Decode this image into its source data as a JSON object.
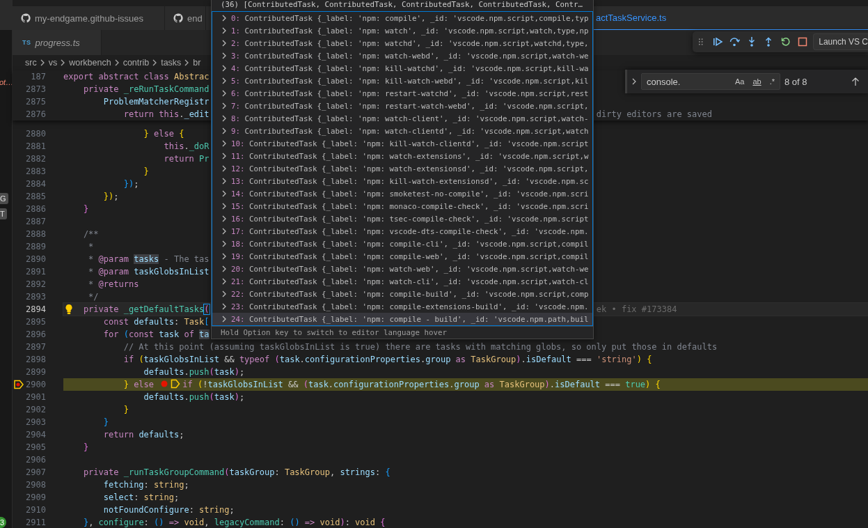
{
  "sidebar_edge": {
    "items": [
      {
        "kind": "text",
        "text": "ot…"
      },
      {
        "kind": "badge",
        "text": "G"
      },
      {
        "kind": "badge",
        "text": "T"
      },
      {
        "kind": "count",
        "text": "3"
      }
    ]
  },
  "tab_rows": [
    [
      {
        "label": "my-endgame.github-issues",
        "kind": "remote",
        "selected": false,
        "preview": false
      },
      {
        "label": "end",
        "kind": "remote",
        "selected": false,
        "preview": false
      },
      {
        "label": "actTaskService.ts",
        "kind": "file",
        "selected": true,
        "preview": false
      }
    ],
    [
      {
        "label": "progress.ts",
        "kind": "file",
        "file_type": "TS",
        "selected": false,
        "preview": true
      }
    ]
  ],
  "breadcrumbs": [
    "src",
    "vs",
    "workbench",
    "contrib",
    "tasks",
    "br"
  ],
  "editor": {
    "sticky_lines": [
      {
        "number": "187",
        "tokens": [
          {
            "text": "export abstract class ",
            "kind": "keyword"
          },
          {
            "text": "Abstrac",
            "kind": "type"
          }
        ]
      },
      {
        "number": "2873",
        "tokens": [
          {
            "text": "    private ",
            "kind": "keyword"
          },
          {
            "text": "_reRunTaskCommand",
            "kind": "function"
          }
        ]
      },
      {
        "number": "2875",
        "tokens": [
          {
            "text": "        ProblemMatcherRegistr",
            "kind": "variable"
          }
        ]
      },
      {
        "number": "2876",
        "tokens": [
          {
            "text": "            return this",
            "kind": "keyword"
          },
          {
            "text": ".",
            "kind": "plain"
          },
          {
            "text": "_edit",
            "kind": "variable"
          }
        ],
        "tail": [
          {
            "text": "dirty editors are saved",
            "kind": "comment"
          }
        ]
      }
    ],
    "lines": [
      {
        "number": "2880",
        "current": false,
        "paused": false,
        "tokens": [
          {
            "text": "                }",
            "kind": "bracket1"
          },
          {
            "text": " else ",
            "kind": "keyword"
          },
          {
            "text": "{",
            "kind": "bracket1"
          }
        ]
      },
      {
        "number": "2881",
        "current": false,
        "paused": false,
        "tokens": [
          {
            "text": "                    this",
            "kind": "keyword"
          },
          {
            "text": ".",
            "kind": "plain"
          },
          {
            "text": "_doR",
            "kind": "function"
          }
        ]
      },
      {
        "number": "2882",
        "current": false,
        "paused": false,
        "tokens": [
          {
            "text": "                    return ",
            "kind": "keyword"
          },
          {
            "text": "Pr",
            "kind": "function"
          }
        ]
      },
      {
        "number": "2883",
        "current": false,
        "paused": false,
        "tokens": [
          {
            "text": "                }",
            "kind": "bracket1"
          }
        ]
      },
      {
        "number": "2884",
        "current": false,
        "paused": false,
        "tokens": [
          {
            "text": "            })",
            "kind": "bracket3"
          },
          {
            "text": ";",
            "kind": "plain"
          }
        ]
      },
      {
        "number": "2885",
        "current": false,
        "paused": false,
        "tokens": [
          {
            "text": "        })",
            "kind": "bracket1"
          },
          {
            "text": ";",
            "kind": "plain"
          }
        ]
      },
      {
        "number": "2886",
        "current": false,
        "paused": false,
        "tokens": [
          {
            "text": "    }",
            "kind": "bracket2"
          }
        ]
      },
      {
        "number": "2887",
        "current": false,
        "paused": false
      },
      {
        "number": "2888",
        "current": false,
        "paused": false,
        "tokens": [
          {
            "text": "    /**",
            "kind": "comment"
          }
        ]
      },
      {
        "number": "2889",
        "current": false,
        "paused": false,
        "tokens": [
          {
            "text": "     *",
            "kind": "comment"
          }
        ]
      },
      {
        "number": "2890",
        "current": false,
        "paused": false,
        "tokens": [
          {
            "text": "     * ",
            "kind": "comment"
          },
          {
            "text": "@param ",
            "kind": "tag"
          },
          {
            "text": "tasks",
            "kind": "match"
          },
          {
            "text": " - The tas",
            "kind": "comment"
          }
        ]
      },
      {
        "number": "2891",
        "current": false,
        "paused": false,
        "tokens": [
          {
            "text": "     * ",
            "kind": "comment"
          },
          {
            "text": "@param ",
            "kind": "tag"
          },
          {
            "text": "taskGlobsInList",
            "kind": "variable"
          }
        ]
      },
      {
        "number": "2892",
        "current": false,
        "paused": false,
        "tokens": [
          {
            "text": "     * ",
            "kind": "comment"
          },
          {
            "text": "@returns",
            "kind": "tag"
          }
        ]
      },
      {
        "number": "2893",
        "current": false,
        "paused": false,
        "tokens": [
          {
            "text": "     */",
            "kind": "comment"
          }
        ]
      },
      {
        "number": "2894",
        "current": true,
        "paused": false,
        "kind": "lightbulb",
        "tokens": [
          {
            "text": "    private ",
            "kind": "keyword"
          },
          {
            "text": "_getDefaultTasks",
            "kind": "function"
          },
          {
            "text": "(",
            "kind": "bracket-match"
          }
        ],
        "tail": [
          {
            "text": "ek • fix #173384",
            "kind": "blame"
          }
        ]
      },
      {
        "number": "2895",
        "current": false,
        "paused": false,
        "tokens": [
          {
            "text": "        const ",
            "kind": "keyword"
          },
          {
            "text": "defaults",
            "kind": "variable"
          },
          {
            "text": ": ",
            "kind": "plain"
          },
          {
            "text": "Task",
            "kind": "type"
          },
          {
            "text": "[",
            "kind": "bracket3"
          }
        ]
      },
      {
        "number": "2896",
        "current": false,
        "paused": false,
        "tokens": [
          {
            "text": "        for ",
            "kind": "keyword"
          },
          {
            "text": "(",
            "kind": "bracket3"
          },
          {
            "text": "const ",
            "kind": "keyword"
          },
          {
            "text": "task",
            "kind": "variable"
          },
          {
            "text": " of ",
            "kind": "keyword"
          },
          {
            "text": "ta",
            "kind": "match"
          }
        ]
      },
      {
        "number": "2897",
        "current": false,
        "paused": false,
        "tokens": [
          {
            "text": "            // At this point (assuming taskGlobsInList is true) there are tasks with matching globs, so only put those in defaults",
            "kind": "comment"
          }
        ]
      },
      {
        "number": "2898",
        "current": false,
        "paused": false,
        "tokens": [
          {
            "text": "            if ",
            "kind": "keyword"
          },
          {
            "text": "(",
            "kind": "bracket1"
          },
          {
            "text": "taskGlobsInList",
            "kind": "variable"
          },
          {
            "text": " && ",
            "kind": "plain"
          },
          {
            "text": "typeof ",
            "kind": "keyword"
          },
          {
            "text": "(",
            "kind": "bracket2"
          },
          {
            "text": "task",
            "kind": "variable"
          },
          {
            "text": ".",
            "kind": "plain"
          },
          {
            "text": "configurationProperties",
            "kind": "variable"
          },
          {
            "text": ".",
            "kind": "plain"
          },
          {
            "text": "group",
            "kind": "variable"
          },
          {
            "text": " as ",
            "kind": "keyword"
          },
          {
            "text": "TaskGroup",
            "kind": "type"
          },
          {
            "text": ")",
            "kind": "bracket2"
          },
          {
            "text": ".",
            "kind": "plain"
          },
          {
            "text": "isDefault",
            "kind": "variable"
          },
          {
            "text": " === ",
            "kind": "plain"
          },
          {
            "text": "'string'",
            "kind": "string"
          },
          {
            "text": ") {",
            "kind": "bracket1"
          }
        ]
      },
      {
        "number": "2899",
        "current": false,
        "paused": false,
        "tokens": [
          {
            "text": "                defaults",
            "kind": "variable"
          },
          {
            "text": ".",
            "kind": "plain"
          },
          {
            "text": "push",
            "kind": "function"
          },
          {
            "text": "(",
            "kind": "bracket2"
          },
          {
            "text": "task",
            "kind": "variable"
          },
          {
            "text": ")",
            "kind": "bracket2"
          },
          {
            "text": ";",
            "kind": "plain"
          }
        ]
      },
      {
        "number": "2900",
        "current": false,
        "paused": true,
        "kind": "paused-breakpoint",
        "tokens": [
          {
            "text": "            }",
            "kind": "bracket1"
          },
          {
            "text": " else ",
            "kind": "keyword"
          },
          {
            "kind": "breakpoint"
          },
          {
            "kind": "stack-frame"
          },
          {
            "text": "if ",
            "kind": "keyword"
          },
          {
            "text": "(",
            "kind": "bracket1"
          },
          {
            "text": "!",
            "kind": "plain"
          },
          {
            "text": "taskGlobsInList",
            "kind": "variable"
          },
          {
            "text": " && ",
            "kind": "plain"
          },
          {
            "text": "(",
            "kind": "bracket2"
          },
          {
            "text": "task",
            "kind": "variable"
          },
          {
            "text": ".",
            "kind": "plain"
          },
          {
            "text": "configurationProperties",
            "kind": "variable"
          },
          {
            "text": ".",
            "kind": "plain"
          },
          {
            "text": "group",
            "kind": "variable"
          },
          {
            "text": " as ",
            "kind": "keyword"
          },
          {
            "text": "TaskGroup",
            "kind": "type"
          },
          {
            "text": ")",
            "kind": "bracket2"
          },
          {
            "text": ".",
            "kind": "plain"
          },
          {
            "text": "isDefault",
            "kind": "variable"
          },
          {
            "text": " === ",
            "kind": "plain"
          },
          {
            "text": "true",
            "kind": "literal"
          },
          {
            "text": ") {",
            "kind": "bracket1"
          }
        ]
      },
      {
        "number": "2901",
        "current": false,
        "paused": false,
        "tokens": [
          {
            "text": "                defaults",
            "kind": "variable"
          },
          {
            "text": ".",
            "kind": "plain"
          },
          {
            "text": "push",
            "kind": "function"
          },
          {
            "text": "(",
            "kind": "bracket2"
          },
          {
            "text": "task",
            "kind": "variable"
          },
          {
            "text": ")",
            "kind": "bracket2"
          },
          {
            "text": ";",
            "kind": "plain"
          }
        ]
      },
      {
        "number": "2902",
        "current": false,
        "paused": false,
        "tokens": [
          {
            "text": "            }",
            "kind": "bracket1"
          }
        ]
      },
      {
        "number": "2903",
        "current": false,
        "paused": false,
        "tokens": [
          {
            "text": "        }",
            "kind": "bracket3"
          }
        ]
      },
      {
        "number": "2904",
        "current": false,
        "paused": false,
        "tokens": [
          {
            "text": "        return ",
            "kind": "keyword"
          },
          {
            "text": "defaults",
            "kind": "variable"
          },
          {
            "text": ";",
            "kind": "plain"
          }
        ]
      },
      {
        "number": "2905",
        "current": false,
        "paused": false,
        "tokens": [
          {
            "text": "    }",
            "kind": "bracket2"
          }
        ]
      },
      {
        "number": "2906",
        "current": false,
        "paused": false
      },
      {
        "number": "2907",
        "current": false,
        "paused": false,
        "tokens": [
          {
            "text": "    private ",
            "kind": "keyword"
          },
          {
            "text": "_runTaskGroupCommand",
            "kind": "function"
          },
          {
            "text": "(",
            "kind": "bracket2"
          },
          {
            "text": "taskGroup",
            "kind": "variable"
          },
          {
            "text": ": ",
            "kind": "plain"
          },
          {
            "text": "TaskGroup",
            "kind": "type"
          },
          {
            "text": ", ",
            "kind": "plain"
          },
          {
            "text": "strings",
            "kind": "variable"
          },
          {
            "text": ": ",
            "kind": "plain"
          },
          {
            "text": "{",
            "kind": "bracket3"
          }
        ]
      },
      {
        "number": "2908",
        "current": false,
        "paused": false,
        "tokens": [
          {
            "text": "        fetching",
            "kind": "variable"
          },
          {
            "text": ": ",
            "kind": "plain"
          },
          {
            "text": "string",
            "kind": "type"
          },
          {
            "text": ";",
            "kind": "plain"
          }
        ]
      },
      {
        "number": "2909",
        "current": false,
        "paused": false,
        "tokens": [
          {
            "text": "        select",
            "kind": "variable"
          },
          {
            "text": ": ",
            "kind": "plain"
          },
          {
            "text": "string",
            "kind": "type"
          },
          {
            "text": ";",
            "kind": "plain"
          }
        ]
      },
      {
        "number": "2910",
        "current": false,
        "paused": false,
        "tokens": [
          {
            "text": "        notFoundConfigure",
            "kind": "variable"
          },
          {
            "text": ": ",
            "kind": "plain"
          },
          {
            "text": "string",
            "kind": "type"
          },
          {
            "text": ";",
            "kind": "plain"
          }
        ]
      },
      {
        "number": "2911",
        "current": false,
        "paused": false,
        "tokens": [
          {
            "text": "    }",
            "kind": "bracket3"
          },
          {
            "text": ", ",
            "kind": "plain"
          },
          {
            "text": "configure",
            "kind": "function"
          },
          {
            "text": ": ",
            "kind": "plain"
          },
          {
            "text": "()",
            "kind": "bracket3"
          },
          {
            "text": " => ",
            "kind": "keyword"
          },
          {
            "text": "void",
            "kind": "type"
          },
          {
            "text": ", ",
            "kind": "plain"
          },
          {
            "text": "legacyCommand",
            "kind": "function"
          },
          {
            "text": ": ",
            "kind": "plain"
          },
          {
            "text": "()",
            "kind": "bracket3"
          },
          {
            "text": " => ",
            "kind": "keyword"
          },
          {
            "text": "void",
            "kind": "type"
          },
          {
            "text": ")",
            "kind": "bracket2"
          },
          {
            "text": ": ",
            "kind": "plain"
          },
          {
            "text": "void ",
            "kind": "type"
          },
          {
            "text": "{",
            "kind": "bracket2"
          }
        ]
      }
    ]
  },
  "hover": {
    "title": "(36) [ContributedTask, ContributedTask, ContributedTask, ContributedTask, Contr…",
    "rows": [
      {
        "key": "0:",
        "value": "ContributedTask {_label: 'npm: compile', _id: 'vscode.npm.script,compile,typ",
        "selected": false
      },
      {
        "key": "1:",
        "value": "ContributedTask {_label: 'npm: watch', _id: 'vscode.npm.script,watch,type,np",
        "selected": false
      },
      {
        "key": "2:",
        "value": "ContributedTask {_label: 'npm: watchd', _id: 'vscode.npm.script,watchd,type,",
        "selected": false
      },
      {
        "key": "3:",
        "value": "ContributedTask {_label: 'npm: watch-webd', _id: 'vscode.npm.script,watch-we",
        "selected": false
      },
      {
        "key": "4:",
        "value": "ContributedTask {_label: 'npm: kill-watchd', _id: 'vscode.npm.script,kill-wa",
        "selected": false
      },
      {
        "key": "5:",
        "value": "ContributedTask {_label: 'npm: kill-watch-webd', _id: 'vscode.npm.script,kil",
        "selected": false
      },
      {
        "key": "6:",
        "value": "ContributedTask {_label: 'npm: restart-watchd', _id: 'vscode.npm.script,rest",
        "selected": false
      },
      {
        "key": "7:",
        "value": "ContributedTask {_label: 'npm: restart-watch-webd', _id: 'vscode.npm.script,",
        "selected": false
      },
      {
        "key": "8:",
        "value": "ContributedTask {_label: 'npm: watch-client', _id: 'vscode.npm.script,watch-",
        "selected": false
      },
      {
        "key": "9:",
        "value": "ContributedTask {_label: 'npm: watch-clientd', _id: 'vscode.npm.script,watch",
        "selected": false
      },
      {
        "key": "10:",
        "value": "ContributedTask {_label: 'npm: kill-watch-clientd', _id: 'vscode.npm.script",
        "selected": false
      },
      {
        "key": "11:",
        "value": "ContributedTask {_label: 'npm: watch-extensions', _id: 'vscode.npm.script,w",
        "selected": false
      },
      {
        "key": "12:",
        "value": "ContributedTask {_label: 'npm: watch-extensionsd', _id: 'vscode.npm.script,",
        "selected": false
      },
      {
        "key": "13:",
        "value": "ContributedTask {_label: 'npm: kill-watch-extensionsd', _id: 'vscode.npm.sc",
        "selected": false
      },
      {
        "key": "14:",
        "value": "ContributedTask {_label: 'npm: smoketest-no-compile', _id: 'vscode.npm.scri",
        "selected": false
      },
      {
        "key": "15:",
        "value": "ContributedTask {_label: 'npm: monaco-compile-check', _id: 'vscode.npm.scri",
        "selected": false
      },
      {
        "key": "16:",
        "value": "ContributedTask {_label: 'npm: tsec-compile-check', _id: 'vscode.npm.script",
        "selected": false
      },
      {
        "key": "17:",
        "value": "ContributedTask {_label: 'npm: vscode-dts-compile-check', _id: 'vscode.npm.",
        "selected": false
      },
      {
        "key": "18:",
        "value": "ContributedTask {_label: 'npm: compile-cli', _id: 'vscode.npm.script,compil",
        "selected": false
      },
      {
        "key": "19:",
        "value": "ContributedTask {_label: 'npm: compile-web', _id: 'vscode.npm.script,compil",
        "selected": false
      },
      {
        "key": "20:",
        "value": "ContributedTask {_label: 'npm: watch-web', _id: 'vscode.npm.script,watch-we",
        "selected": false
      },
      {
        "key": "21:",
        "value": "ContributedTask {_label: 'npm: watch-cli', _id: 'vscode.npm.script,watch-cl",
        "selected": false
      },
      {
        "key": "22:",
        "value": "ContributedTask {_label: 'npm: compile-build', _id: 'vscode.npm.script,comp",
        "selected": false
      },
      {
        "key": "23:",
        "value": "ContributedTask {_label: 'npm: compile-extensions-build', _id: 'vscode.npm.",
        "selected": false
      },
      {
        "key": "24:",
        "value": "ContributedTask {_label: 'npm: compile - build', _id: 'vscode.npm.path,buil",
        "selected": true
      }
    ],
    "status": "Hold Option key to switch to editor language hover"
  },
  "find": {
    "value": "console.",
    "toggles": [
      {
        "label": "Aa",
        "checked": false
      },
      {
        "label": "ab",
        "checked": false
      },
      {
        "label": ".*",
        "checked": false
      }
    ],
    "result": "8 of 8"
  },
  "debug_toolbar": {
    "buttons": [
      {
        "kind": "continue"
      },
      {
        "kind": "step-over"
      },
      {
        "kind": "step-into"
      },
      {
        "kind": "step-out"
      },
      {
        "kind": "restart"
      },
      {
        "kind": "stop"
      }
    ],
    "configuration": "Launch VS C"
  }
}
